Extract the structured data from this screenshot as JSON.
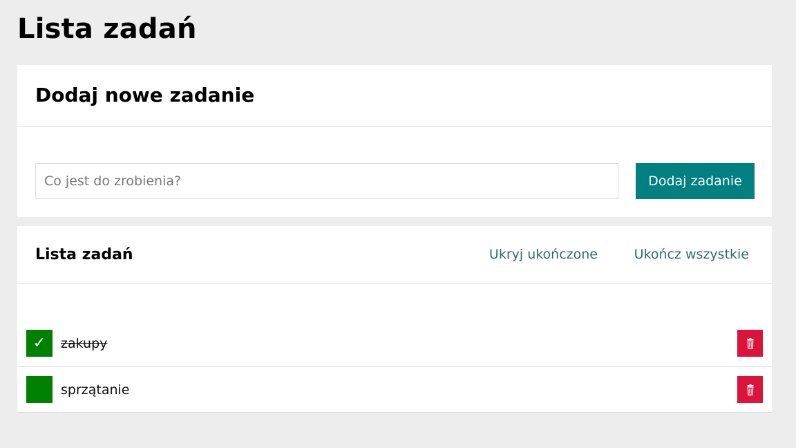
{
  "page": {
    "title": "Lista zadań"
  },
  "add_section": {
    "heading": "Dodaj nowe zadanie",
    "input_value": "",
    "input_placeholder": "Co jest do zrobienia?",
    "button_label": "Dodaj zadanie"
  },
  "list_section": {
    "heading": "Lista zadań",
    "hide_done_label": "Ukryj ukończone",
    "finish_all_label": "Ukończ wszystkie",
    "tasks": [
      {
        "text": "zakupy",
        "done": true,
        "check_mark": "✓"
      },
      {
        "text": "sprzątanie",
        "done": false,
        "check_mark": ""
      }
    ]
  },
  "icons": {
    "remove": "trash-icon",
    "done": "check-icon"
  },
  "colors": {
    "background": "#ededed",
    "accent": "#008080",
    "toggle": "#008000",
    "remove": "#dc143c",
    "link": "#2e6b70"
  }
}
